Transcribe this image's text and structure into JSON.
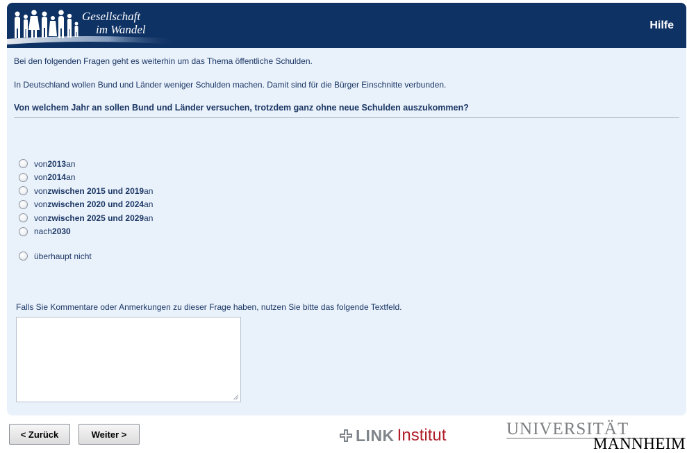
{
  "header": {
    "logo_line1": "Gesellschaft",
    "logo_line2": "im Wandel",
    "help_label": "Hilfe"
  },
  "intro": {
    "line1": "Bei den folgenden Fragen geht es weiterhin um das Thema öffentliche Schulden.",
    "line2": "In Deutschland wollen Bund und Länder weniger Schulden machen. Damit sind für die Bürger Einschnitte verbunden."
  },
  "question": "Von welchem Jahr an sollen Bund und Länder versuchen, trotzdem ganz ohne neue Schulden auszukommen?",
  "options": [
    {
      "pre": "von ",
      "bold": "2013",
      "post": " an"
    },
    {
      "pre": "von ",
      "bold": "2014",
      "post": " an"
    },
    {
      "pre": "von ",
      "bold": "zwischen 2015 und 2019",
      "post": " an"
    },
    {
      "pre": "von ",
      "bold": "zwischen 2020 und 2024",
      "post": " an"
    },
    {
      "pre": "von ",
      "bold": "zwischen 2025 und 2029",
      "post": " an"
    },
    {
      "pre": "nach ",
      "bold": "2030",
      "post": ""
    },
    {
      "pre": "überhaupt nicht",
      "bold": "",
      "post": ""
    }
  ],
  "comment": {
    "label": "Falls Sie Kommentare oder Anmerkungen zu dieser Frage haben, nutzen Sie bitte das folgende Textfeld.",
    "value": ""
  },
  "nav": {
    "back_label": "< Zurück",
    "next_label": "Weiter >"
  },
  "footer": {
    "link_word": "LINK",
    "institut_word": "Institut",
    "uni_line1": "UNIVERSITÄT",
    "uni_line2": "MANNHEIM"
  },
  "colors": {
    "header_bg": "#0f3264",
    "panel_bg": "#e9f1fb",
    "text": "#1b3764",
    "institut_red": "#b01e2a"
  }
}
